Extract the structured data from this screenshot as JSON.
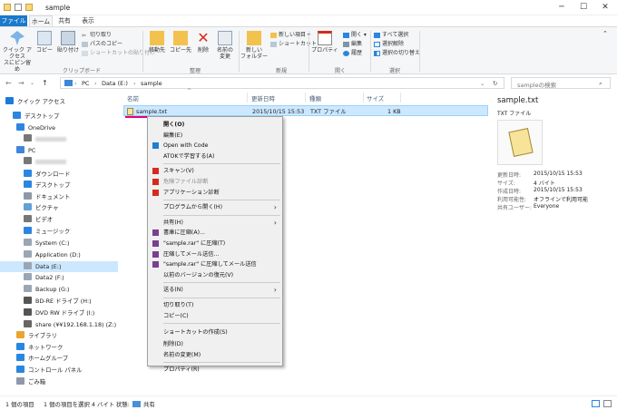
{
  "window": {
    "title": "sample"
  },
  "tabs": [
    "ファイル",
    "ホーム",
    "共有",
    "表示"
  ],
  "ribbon": {
    "clipboard": {
      "pin": "クイック アクセス\nスにピン留め",
      "copy": "コピー",
      "paste": "貼り付け",
      "cut": "切り取り",
      "copy_path": "パスのコピー",
      "paste_shortcut": "ショートカットの貼り付け",
      "group": "クリップボード"
    },
    "organize": {
      "move": "移動先",
      "copy_to": "コピー先",
      "delete": "削除",
      "rename": "名前の\n変更",
      "group": "整理"
    },
    "new": {
      "folder": "新しい\nフォルダー",
      "item": "新しい項目",
      "shortcut": "ショートカット",
      "group": "新規"
    },
    "open": {
      "properties": "プロパティ",
      "open": "開く",
      "edit": "編集",
      "history": "履歴",
      "group": "開く"
    },
    "select": {
      "all": "すべて選択",
      "none": "選択解除",
      "invert": "選択の切り替え",
      "group": "選択"
    }
  },
  "address": {
    "parts": [
      "PC",
      "Data (E:)",
      "sample"
    ],
    "search_placeholder": "sampleの検索"
  },
  "nav_pane": [
    {
      "label": "クイック アクセス",
      "icon": "star-icon",
      "color": "#1e7ad8"
    },
    {
      "label": "デスクトップ",
      "icon": "desktop-icon",
      "color": "#2a86e0"
    },
    {
      "label": "OneDrive",
      "icon": "cloud-icon",
      "color": "#2a86e0"
    },
    {
      "label": "",
      "icon": "user-icon",
      "color": "#777"
    },
    {
      "label": "PC",
      "icon": "pc-icon",
      "color": "#3f86d8"
    },
    {
      "label": "",
      "icon": "user-icon",
      "color": "#777"
    },
    {
      "label": "ダウンロード",
      "icon": "download-icon",
      "color": "#2a86e0"
    },
    {
      "label": "デスクトップ",
      "icon": "desktop-icon",
      "color": "#2a86e0"
    },
    {
      "label": "ドキュメント",
      "icon": "document-icon",
      "color": "#8e98a8"
    },
    {
      "label": "ピクチャ",
      "icon": "pictures-icon",
      "color": "#62a0d8"
    },
    {
      "label": "ビデオ",
      "icon": "video-icon",
      "color": "#777"
    },
    {
      "label": "ミュージック",
      "icon": "music-icon",
      "color": "#2a86e0"
    },
    {
      "label": "System (C:)",
      "icon": "drive-icon",
      "color": "#9aa6b4"
    },
    {
      "label": "Application (D:)",
      "icon": "drive-icon",
      "color": "#9aa6b4"
    },
    {
      "label": "Data (E:)",
      "icon": "drive-icon",
      "color": "#9aa6b4",
      "selected": true
    },
    {
      "label": "Data2 (F:)",
      "icon": "drive-icon",
      "color": "#9aa6b4"
    },
    {
      "label": "Backup (G:)",
      "icon": "drive-icon",
      "color": "#9aa6b4"
    },
    {
      "label": "BD-RE ドライブ (H:)",
      "icon": "disc-icon",
      "color": "#555"
    },
    {
      "label": "DVD RW ドライブ (I:)",
      "icon": "disc-icon",
      "color": "#555"
    },
    {
      "label": "share (¥¥192.168.1.18) (Z:)",
      "icon": "network-drive-icon",
      "color": "#666"
    },
    {
      "label": "ライブラリ",
      "icon": "library-icon",
      "color": "#e8a630"
    },
    {
      "label": "ネットワーク",
      "icon": "network-icon",
      "color": "#2a86e0"
    },
    {
      "label": "ホームグループ",
      "icon": "homegroup-icon",
      "color": "#2a86e0"
    },
    {
      "label": "コントロール パネル",
      "icon": "control-panel-icon",
      "color": "#2a86e0"
    },
    {
      "label": "ごみ箱",
      "icon": "recycle-bin-icon",
      "color": "#8e98a8"
    }
  ],
  "columns": [
    "名前",
    "更新日時",
    "種類",
    "サイズ"
  ],
  "file": {
    "name": "sample.txt",
    "modified": "2015/10/15 15:53",
    "type": "TXT ファイル",
    "size": "1 KB"
  },
  "context_menu": [
    {
      "label": "開く(O)",
      "bold": true
    },
    {
      "label": "編集(E)"
    },
    {
      "label": "Open with Code",
      "icon": "vscode-icon"
    },
    {
      "label": "ATOKで学習する(A)"
    },
    {
      "sep": true
    },
    {
      "label": "スキャン(V)",
      "icon": "kaspersky-icon"
    },
    {
      "label": "危険ファイル診断",
      "icon": "kaspersky-icon",
      "disabled": true
    },
    {
      "label": "アプリケーション診断",
      "icon": "kaspersky-icon"
    },
    {
      "sep": true
    },
    {
      "label": "プログラムから開く(H)",
      "sub": true
    },
    {
      "sep": true
    },
    {
      "label": "共有(H)",
      "sub": true
    },
    {
      "label": "書庫に圧縮(A)...",
      "icon": "winrar-icon"
    },
    {
      "label": "\"sample.rar\" に圧縮(T)",
      "icon": "winrar-icon"
    },
    {
      "label": "圧縮してメール送信...",
      "icon": "winrar-icon"
    },
    {
      "label": "\"sample.rar\" に圧縮してメール送信",
      "icon": "winrar-icon"
    },
    {
      "label": "以前のバージョンの復元(V)"
    },
    {
      "sep": true
    },
    {
      "label": "送る(N)",
      "sub": true
    },
    {
      "sep": true
    },
    {
      "label": "切り取り(T)"
    },
    {
      "label": "コピー(C)"
    },
    {
      "sep": true
    },
    {
      "label": "ショートカットの作成(S)",
      "highlight": true
    },
    {
      "label": "削除(D)"
    },
    {
      "label": "名前の変更(M)"
    },
    {
      "sep": true
    },
    {
      "label": "プロパティ(R)"
    }
  ],
  "details": {
    "title": "sample.txt",
    "type": "TXT ファイル",
    "props": [
      [
        "更新日時:",
        "2015/10/15 15:53"
      ],
      [
        "サイズ:",
        "4 バイト"
      ],
      [
        "作成日時:",
        "2015/10/15 15:53"
      ],
      [
        "利用可能性:",
        "オフラインで利用可能"
      ],
      [
        "共有ユーザー:",
        "Everyone"
      ]
    ]
  },
  "status": {
    "count": "1 個の項目",
    "selected": "1 個の項目を選択 4 バイト",
    "state_label": "状態:",
    "state": "共有"
  },
  "colors": {
    "accent": "#1979ca",
    "highlight": "#e4007f",
    "selection": "#cce8ff"
  }
}
